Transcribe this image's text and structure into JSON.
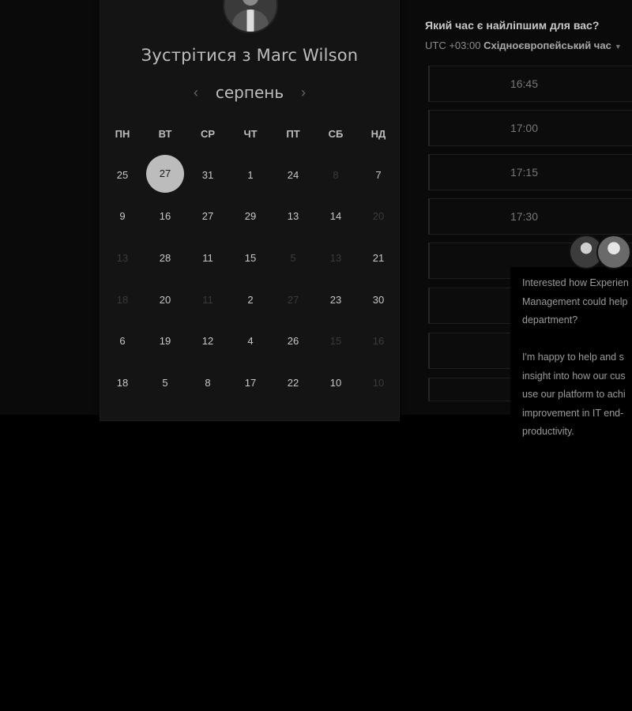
{
  "calendar": {
    "title": "Зустрітися з Marc Wilson",
    "month": "серпень",
    "prev_icon": "‹",
    "next_icon": "›",
    "weekdays": [
      "ПН",
      "ВТ",
      "СР",
      "ЧТ",
      "ПТ",
      "СБ",
      "НД"
    ],
    "selected_day": "27",
    "days": [
      {
        "t": "25",
        "dim": false
      },
      {
        "t": "27",
        "dim": false,
        "sel": true
      },
      {
        "t": "31",
        "dim": false
      },
      {
        "t": "1",
        "dim": false
      },
      {
        "t": "24",
        "dim": false
      },
      {
        "t": "8",
        "dim": true
      },
      {
        "t": "7",
        "dim": false
      },
      {
        "t": "9",
        "dim": false
      },
      {
        "t": "16",
        "dim": false
      },
      {
        "t": "27",
        "dim": false
      },
      {
        "t": "29",
        "dim": false
      },
      {
        "t": "13",
        "dim": false
      },
      {
        "t": "14",
        "dim": false
      },
      {
        "t": "20",
        "dim": true
      },
      {
        "t": "13",
        "dim": true
      },
      {
        "t": "28",
        "dim": false
      },
      {
        "t": "11",
        "dim": false
      },
      {
        "t": "15",
        "dim": false
      },
      {
        "t": "5",
        "dim": true
      },
      {
        "t": "13",
        "dim": true
      },
      {
        "t": "21",
        "dim": false
      },
      {
        "t": "18",
        "dim": true
      },
      {
        "t": "20",
        "dim": false
      },
      {
        "t": "11",
        "dim": true
      },
      {
        "t": "2",
        "dim": false
      },
      {
        "t": "27",
        "dim": true
      },
      {
        "t": "23",
        "dim": false
      },
      {
        "t": "30",
        "dim": false
      },
      {
        "t": "6",
        "dim": false
      },
      {
        "t": "19",
        "dim": false
      },
      {
        "t": "12",
        "dim": false
      },
      {
        "t": "4",
        "dim": false
      },
      {
        "t": "26",
        "dim": false
      },
      {
        "t": "15",
        "dim": true
      },
      {
        "t": "16",
        "dim": true
      },
      {
        "t": "18",
        "dim": false
      },
      {
        "t": "5",
        "dim": false
      },
      {
        "t": "8",
        "dim": false
      },
      {
        "t": "17",
        "dim": false
      },
      {
        "t": "22",
        "dim": false
      },
      {
        "t": "10",
        "dim": false
      },
      {
        "t": "10",
        "dim": true
      }
    ]
  },
  "times": {
    "question": "Який час є найліпшим для вас?",
    "tz_offset": "UTC +03:00",
    "tz_name": "Східноєвропейський час",
    "slots": [
      "16:45",
      "17:00",
      "17:15",
      "17:30",
      "",
      "",
      "",
      ""
    ]
  },
  "chat": {
    "message": "Interested how Experien\nManagement could help\ndepartment?\n\nI'm happy to help and s\ninsight into how our cus\nuse our platform to achi\nimprovement in IT end-\nproductivity."
  },
  "colors": {
    "background": "#000000",
    "card": "#141414",
    "selected_day": "#bcbcbc"
  }
}
